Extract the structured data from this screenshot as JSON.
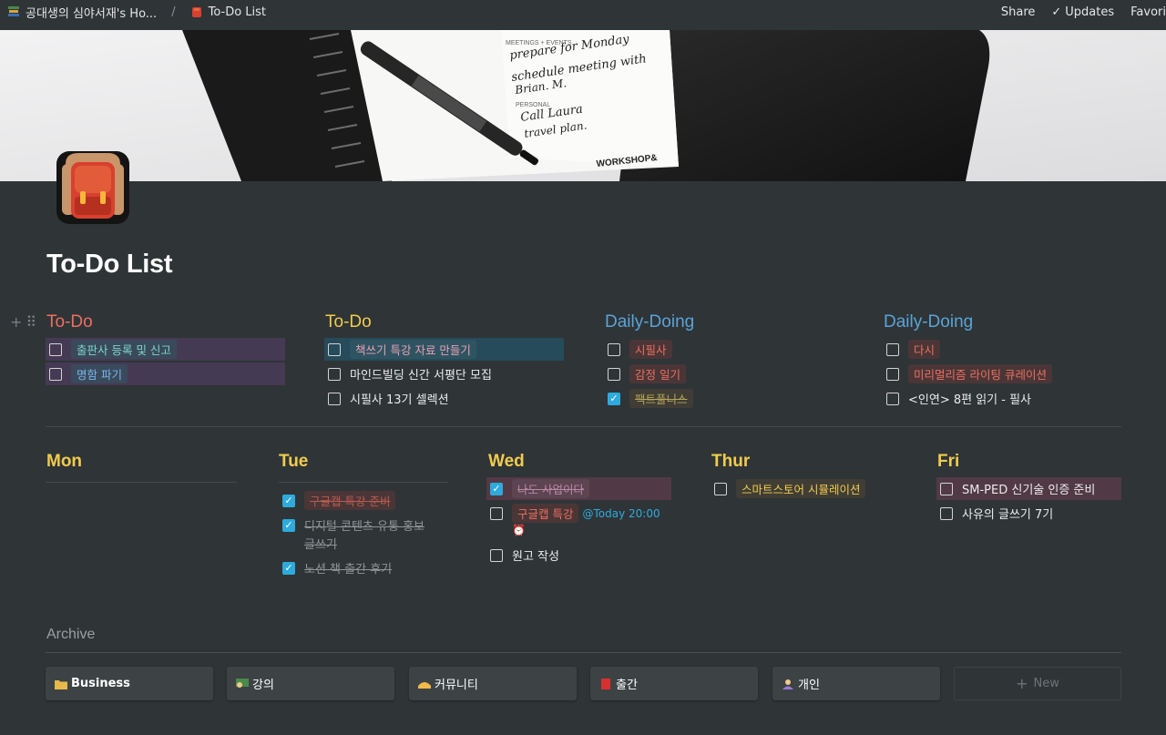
{
  "topbar": {
    "workspace": "공대생의 심야서재's Ho...",
    "page": "To-Do List",
    "share": "Share",
    "updates": "Updates",
    "favorite": "Favori"
  },
  "cover_text": {
    "meetings": "MEETINGS + EVENTS",
    "line1": "prepare for Monday",
    "line2": "schedule meeting with",
    "line3": "Brian. M.",
    "personal": "PERSONAL",
    "line4": "Call Laura",
    "line5": "travel plan.",
    "brand": "WORKSHOP&"
  },
  "title": "To-Do List",
  "columns": [
    {
      "heading": "To-Do",
      "color": "#eb6f60",
      "items": [
        {
          "text": "출판사 등록 및 신고",
          "checked": false
        },
        {
          "text": "명함 파기",
          "checked": false
        }
      ]
    },
    {
      "heading": "To-Do",
      "color": "#f0cc4d",
      "items": [
        {
          "text": "책쓰기 특강 자료 만들기",
          "checked": false
        },
        {
          "text": "마인드빌딩 신간 서평단 모집",
          "checked": false
        },
        {
          "text": "시필사 13기 셀렉션",
          "checked": false
        }
      ]
    },
    {
      "heading": "Daily-Doing",
      "color": "#5aa4d6",
      "items": [
        {
          "text": "시필사",
          "checked": false
        },
        {
          "text": "감정 일기",
          "checked": false
        },
        {
          "text": "팩트풀니스",
          "checked": true
        }
      ]
    },
    {
      "heading": "Daily-Doing",
      "color": "#5aa4d6",
      "items": [
        {
          "text": "다시",
          "checked": false
        },
        {
          "text": "미리멀리즘 라이팅 큐레이션",
          "checked": false
        },
        {
          "text": "<인연> 8편 읽기 - 필사",
          "checked": false
        }
      ]
    }
  ],
  "days": {
    "mon": {
      "heading": "Mon"
    },
    "tue": {
      "heading": "Tue",
      "items": [
        {
          "text": "구글캡 특강 준비",
          "checked": true
        },
        {
          "text_a": "디지털 콘텐츠 유통 홍보",
          "text_b": "글쓰기",
          "checked": true
        },
        {
          "text": "노션 책 출간 후기",
          "checked": true
        }
      ]
    },
    "wed": {
      "heading": "Wed",
      "items": [
        {
          "text": "나도 사업이다",
          "checked": true
        },
        {
          "text": "구글캡 특강",
          "reminder": "@Today 20:00",
          "checked": false
        },
        {
          "text": "원고 작성",
          "checked": false
        }
      ]
    },
    "thur": {
      "heading": "Thur",
      "items": [
        {
          "text": "스마트스토어 시뮬레이션",
          "checked": false
        }
      ]
    },
    "fri": {
      "heading": "Fri",
      "items": [
        {
          "text": "SM-PED 신기술 인증 준비",
          "checked": false
        },
        {
          "text": "사유의 글쓰기 7기",
          "checked": false
        }
      ]
    }
  },
  "archive": {
    "label": "Archive",
    "cards": [
      {
        "label": "Business",
        "icon": "folder-icon"
      },
      {
        "label": "강의",
        "icon": "teacher-icon"
      },
      {
        "label": "커뮤니티",
        "icon": "handshake-icon"
      },
      {
        "label": "출간",
        "icon": "book-icon"
      },
      {
        "label": "개인",
        "icon": "person-icon"
      }
    ],
    "new_label": "New"
  },
  "colors": {
    "background": "#2f3437",
    "red": "#eb6f60",
    "yellow": "#f0cc4d",
    "blue": "#5aa4d6",
    "check": "#2eaadc",
    "purple_row": "#453a54",
    "teal_row": "#264b5a",
    "pink_row": "#513a45"
  }
}
